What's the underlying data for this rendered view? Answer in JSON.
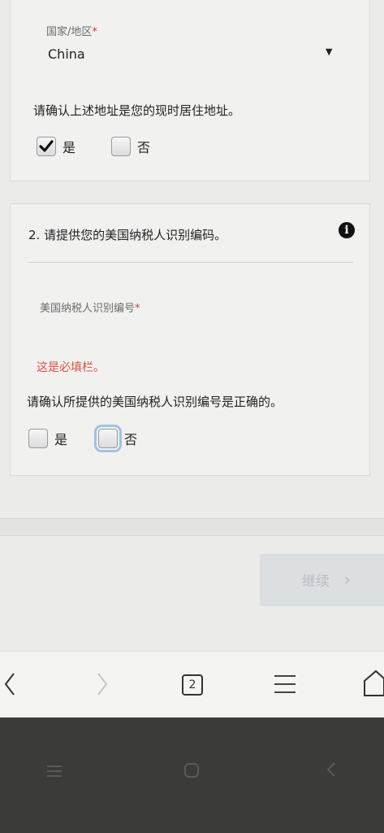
{
  "address_section": {
    "country_label": "国家/地区",
    "required_mark": "*",
    "country_value": "China",
    "confirm_text": "请确认上述地址是您的现时居住地址。",
    "yes_label": "是",
    "no_label": "否",
    "yes_checked": true,
    "no_checked": false
  },
  "tin_section": {
    "title": "2. 请提供您的美国纳税人识别编码。",
    "field_label": "美国纳税人识别编号",
    "required_mark": "*",
    "error_text": "这是必填栏。",
    "confirm_text": "请确认所提供的美国纳税人识别编号是正确的。",
    "yes_label": "是",
    "no_label": "否",
    "yes_checked": false,
    "no_checked": false
  },
  "footer": {
    "continue_label": "继续",
    "continue_arrow": "›"
  },
  "browser_toolbar": {
    "tab_count": "2"
  },
  "colors": {
    "error": "#d9543f",
    "disabled_button_bg": "#dcdfe2",
    "focus_outline": "#9ec3e6"
  }
}
